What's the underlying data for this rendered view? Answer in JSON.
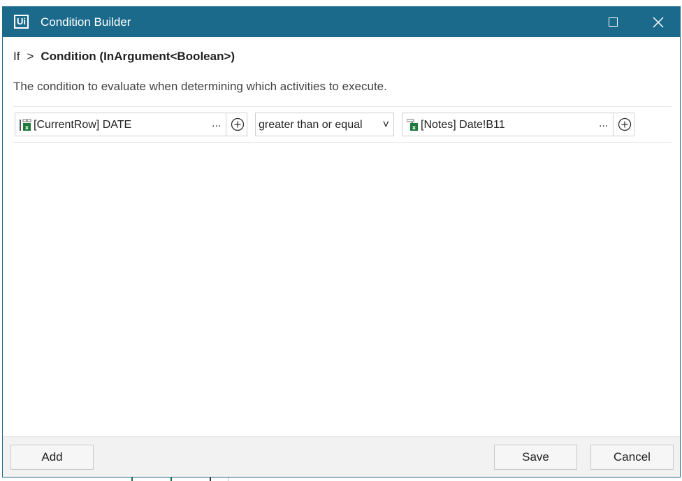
{
  "window": {
    "title": "Condition Builder",
    "logo_text": "Ui",
    "maximize_icon": "maximize-icon",
    "close_icon": "close-icon"
  },
  "breadcrumb": {
    "root": "If",
    "separator": ">",
    "current": "Condition (InArgument<Boolean>)"
  },
  "description": "The condition to evaluate when determining which activities to execute.",
  "condition": {
    "left_operand": {
      "value": "[CurrentRow] DATE",
      "icon": "excel-column-icon",
      "more_label": "..."
    },
    "operator": {
      "selected": "greater than or equal",
      "chevron": "˅"
    },
    "right_operand": {
      "value": "[Notes] Date!B11",
      "icon": "excel-cell-icon",
      "more_label": "..."
    }
  },
  "footer": {
    "add_label": "Add",
    "save_label": "Save",
    "cancel_label": "Cancel"
  },
  "colors": {
    "titlebar": "#1b6a8c",
    "excel_green": "#1d7a3a"
  }
}
